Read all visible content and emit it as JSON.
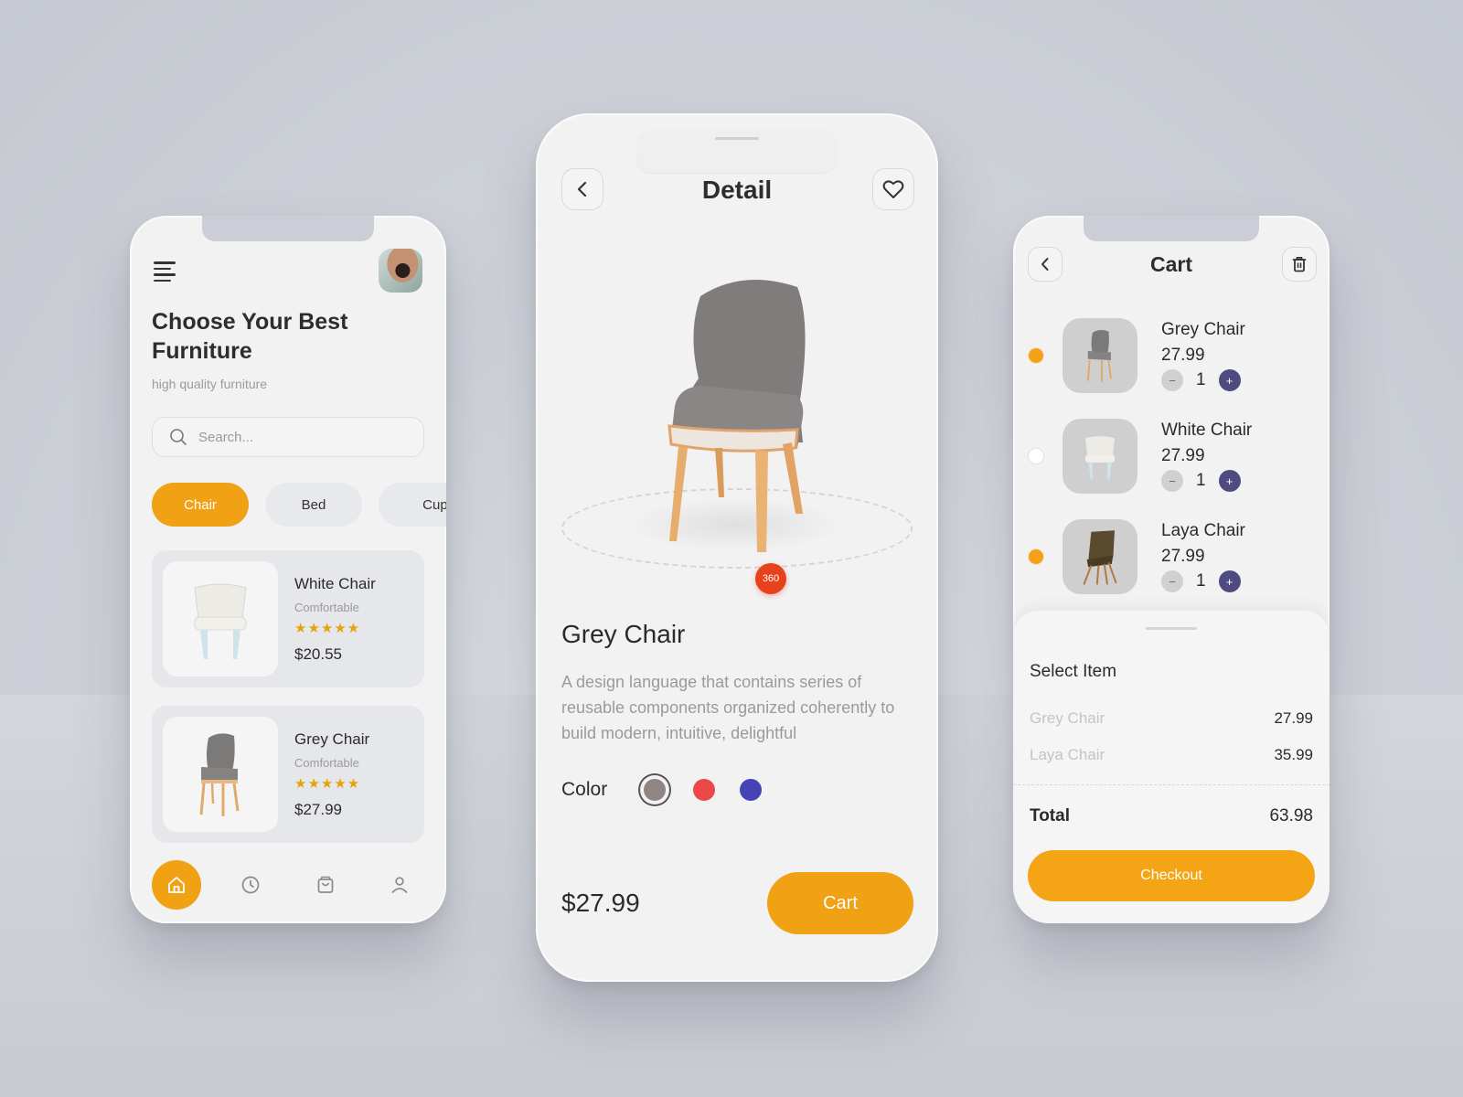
{
  "home": {
    "title": "Choose Your Best Furniture",
    "subtitle": "high quality furniture",
    "search_placeholder": "Search...",
    "categories": [
      {
        "label": "Chair",
        "active": true
      },
      {
        "label": "Bed",
        "active": false
      },
      {
        "label": "Cupb",
        "active": false
      }
    ],
    "products": [
      {
        "name": "White Chair",
        "tag": "Comfortable",
        "rating": 5,
        "stars": "★★★★★",
        "price": "$20.55"
      },
      {
        "name": "Grey Chair",
        "tag": "Comfortable",
        "rating": 5,
        "stars": "★★★★★",
        "price": "$27.99"
      }
    ],
    "nav": [
      {
        "icon": "home-icon",
        "active": true
      },
      {
        "icon": "clock-icon",
        "active": false
      },
      {
        "icon": "bag-icon",
        "active": false
      },
      {
        "icon": "user-icon",
        "active": false
      }
    ]
  },
  "detail": {
    "title": "Detail",
    "badge_360": "360",
    "product_name": "Grey Chair",
    "description": "A design language that contains series of reusable components organized coherently to build modern, intuitive, delightful",
    "color_label": "Color",
    "colors": [
      "#8f8583",
      "#ec4848",
      "#4643b4"
    ],
    "selected_color": "#8f8583",
    "price": "$27.99",
    "cart_label": "Cart"
  },
  "cart": {
    "title": "Cart",
    "items": [
      {
        "name": "Grey Chair",
        "price": "27.99",
        "qty": "1",
        "selected": true
      },
      {
        "name": "White Chair",
        "price": "27.99",
        "qty": "1",
        "selected": false
      },
      {
        "name": "Laya Chair",
        "price": "27.99",
        "qty": "1",
        "selected": true
      }
    ],
    "summary": {
      "title": "Select Item",
      "rows": [
        {
          "label": "Grey Chair",
          "value": "27.99"
        },
        {
          "label": "Laya Chair",
          "value": "35.99"
        }
      ],
      "total_label": "Total",
      "total_value": "63.98",
      "checkout_label": "Checkout"
    }
  },
  "colors": {
    "accent": "#f0a114",
    "badge": "#e8421c",
    "plus": "#4d4b80"
  }
}
